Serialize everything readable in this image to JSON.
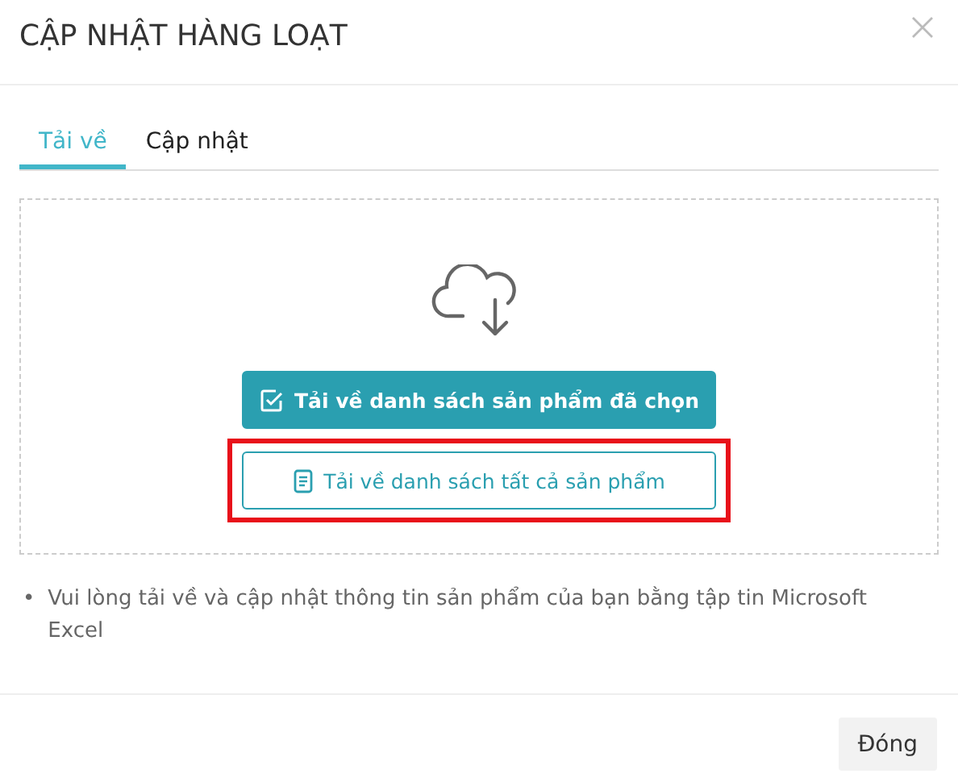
{
  "dialog": {
    "title": "CẬP NHẬT HÀNG LOẠT"
  },
  "tabs": [
    {
      "label": "Tải về",
      "selected": true
    },
    {
      "label": "Cập nhật",
      "selected": false
    }
  ],
  "download_panel": {
    "buttons": [
      {
        "label": "Tải về danh sách sản phẩm đã chọn",
        "kind": "primary",
        "highlighted": false
      },
      {
        "label": "Tải về danh sách tất cả sản phẩm",
        "kind": "outline",
        "highlighted": true
      }
    ]
  },
  "notes": [
    {
      "bullet": "•",
      "text": "Vui lòng tải về và cập nhật thông tin sản phẩm của bạn bằng tập tin Microsoft Excel"
    }
  ],
  "footer": {
    "buttons": [
      "Đóng"
    ]
  }
}
